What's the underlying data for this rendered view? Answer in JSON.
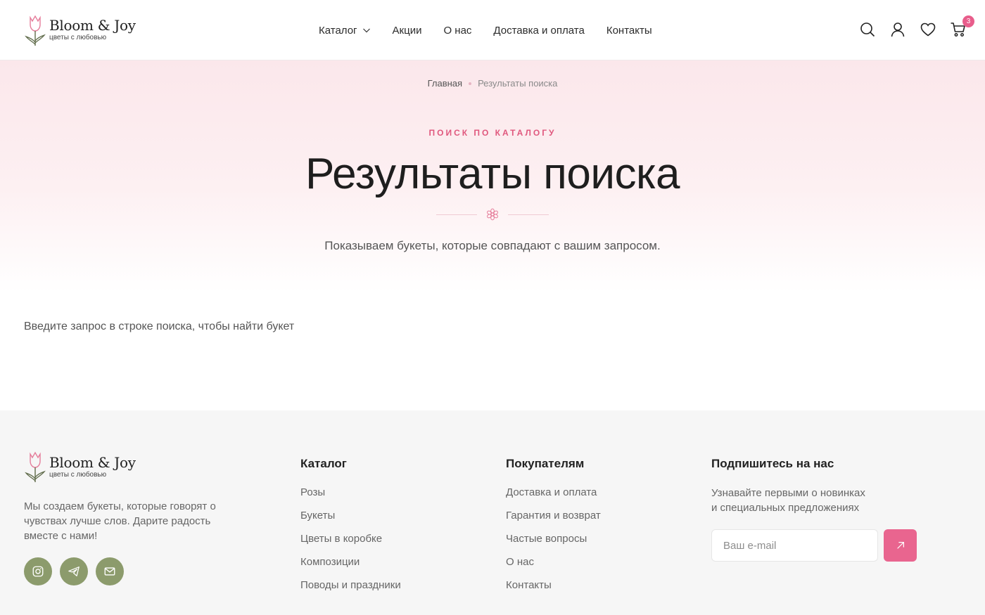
{
  "brand": {
    "name": "Bloom & Joy",
    "tagline": "цветы с любовью"
  },
  "nav": [
    "Каталог",
    "Акции",
    "О нас",
    "Доставка и оплата",
    "Контакты"
  ],
  "header_icons": {
    "search": "search-icon",
    "account": "user-icon",
    "wishlist": "heart-icon",
    "cart": "cart-icon",
    "cart_count": "3"
  },
  "hero": {
    "breadcrumb": {
      "home": "Главная",
      "current": "Результаты поиска"
    },
    "eyebrow": "ПОИСК ПО КАТАЛОГУ",
    "title": "Результаты поиска",
    "subtitle": "Показываем букеты, которые совпадают с вашим запросом."
  },
  "main": {
    "empty_message": "Введите запрос в строке поиска, чтобы найти букет"
  },
  "footer": {
    "about": "Мы создаем букеты, которые говорят о чувствах лучше слов. Дарите радость вместе с нами!",
    "socials": [
      "instagram-icon",
      "telegram-icon",
      "mail-icon"
    ],
    "catalog": {
      "title": "Каталог",
      "links": [
        "Розы",
        "Букеты",
        "Цветы в коробке",
        "Композиции",
        "Поводы и праздники"
      ]
    },
    "customers": {
      "title": "Покупателям",
      "links": [
        "Доставка и оплата",
        "Гарантия и возврат",
        "Частые вопросы",
        "О нас",
        "Контакты"
      ]
    },
    "subscribe": {
      "title": "Подпишитесь на нас",
      "text_line1": "Узнавайте первыми о новинках",
      "text_line2": "и специальных предложениях",
      "placeholder": "Ваш e-mail"
    }
  },
  "colors": {
    "accent_pink": "#e9658f",
    "social_green": "#8c9b6c"
  }
}
